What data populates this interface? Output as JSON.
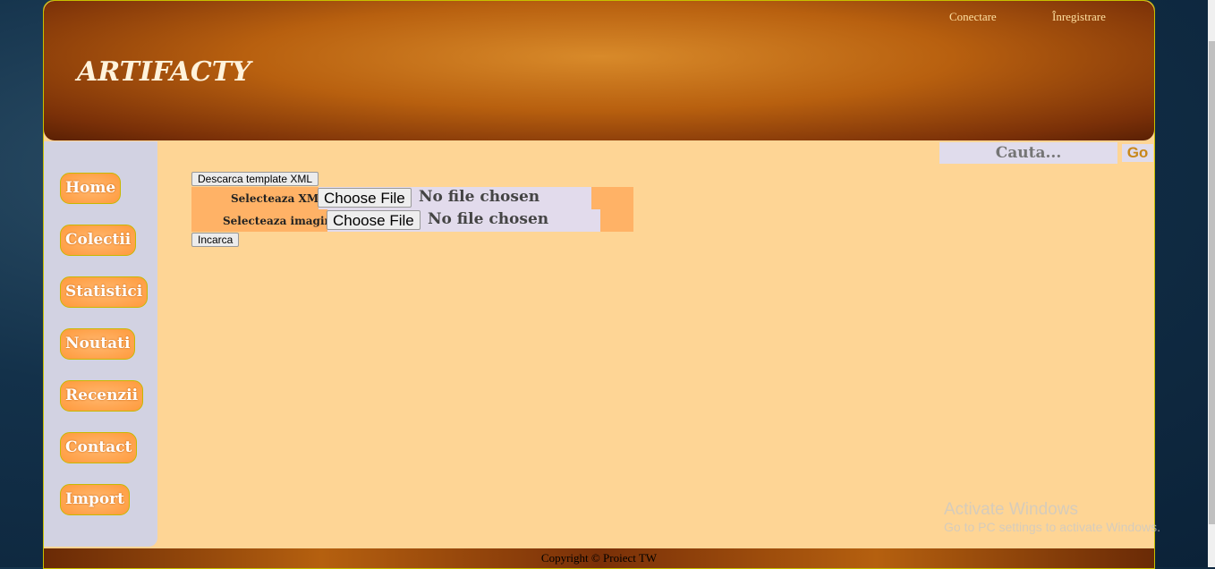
{
  "header": {
    "logo": "ARTIFACTY",
    "login": "Conectare",
    "register": "Înregistrare"
  },
  "search": {
    "placeholder": "Cauta...",
    "go": "Go"
  },
  "sidebar": {
    "items": [
      {
        "label": "Home"
      },
      {
        "label": "Colectii"
      },
      {
        "label": "Statistici"
      },
      {
        "label": "Noutati"
      },
      {
        "label": "Recenzii"
      },
      {
        "label": "Contact"
      },
      {
        "label": "Import"
      }
    ]
  },
  "main": {
    "download_template": "Descarca template XML",
    "xml_label": "Selecteaza XML:",
    "image_label": "Selecteaza imagine:",
    "choose_file": "Choose File",
    "no_file": "No file chosen",
    "upload": "Incarca"
  },
  "footer": {
    "copyright": "Copyright © Proiect TW"
  },
  "watermark": {
    "title": "Activate Windows",
    "subtitle": "Go to PC settings to activate Windows."
  }
}
